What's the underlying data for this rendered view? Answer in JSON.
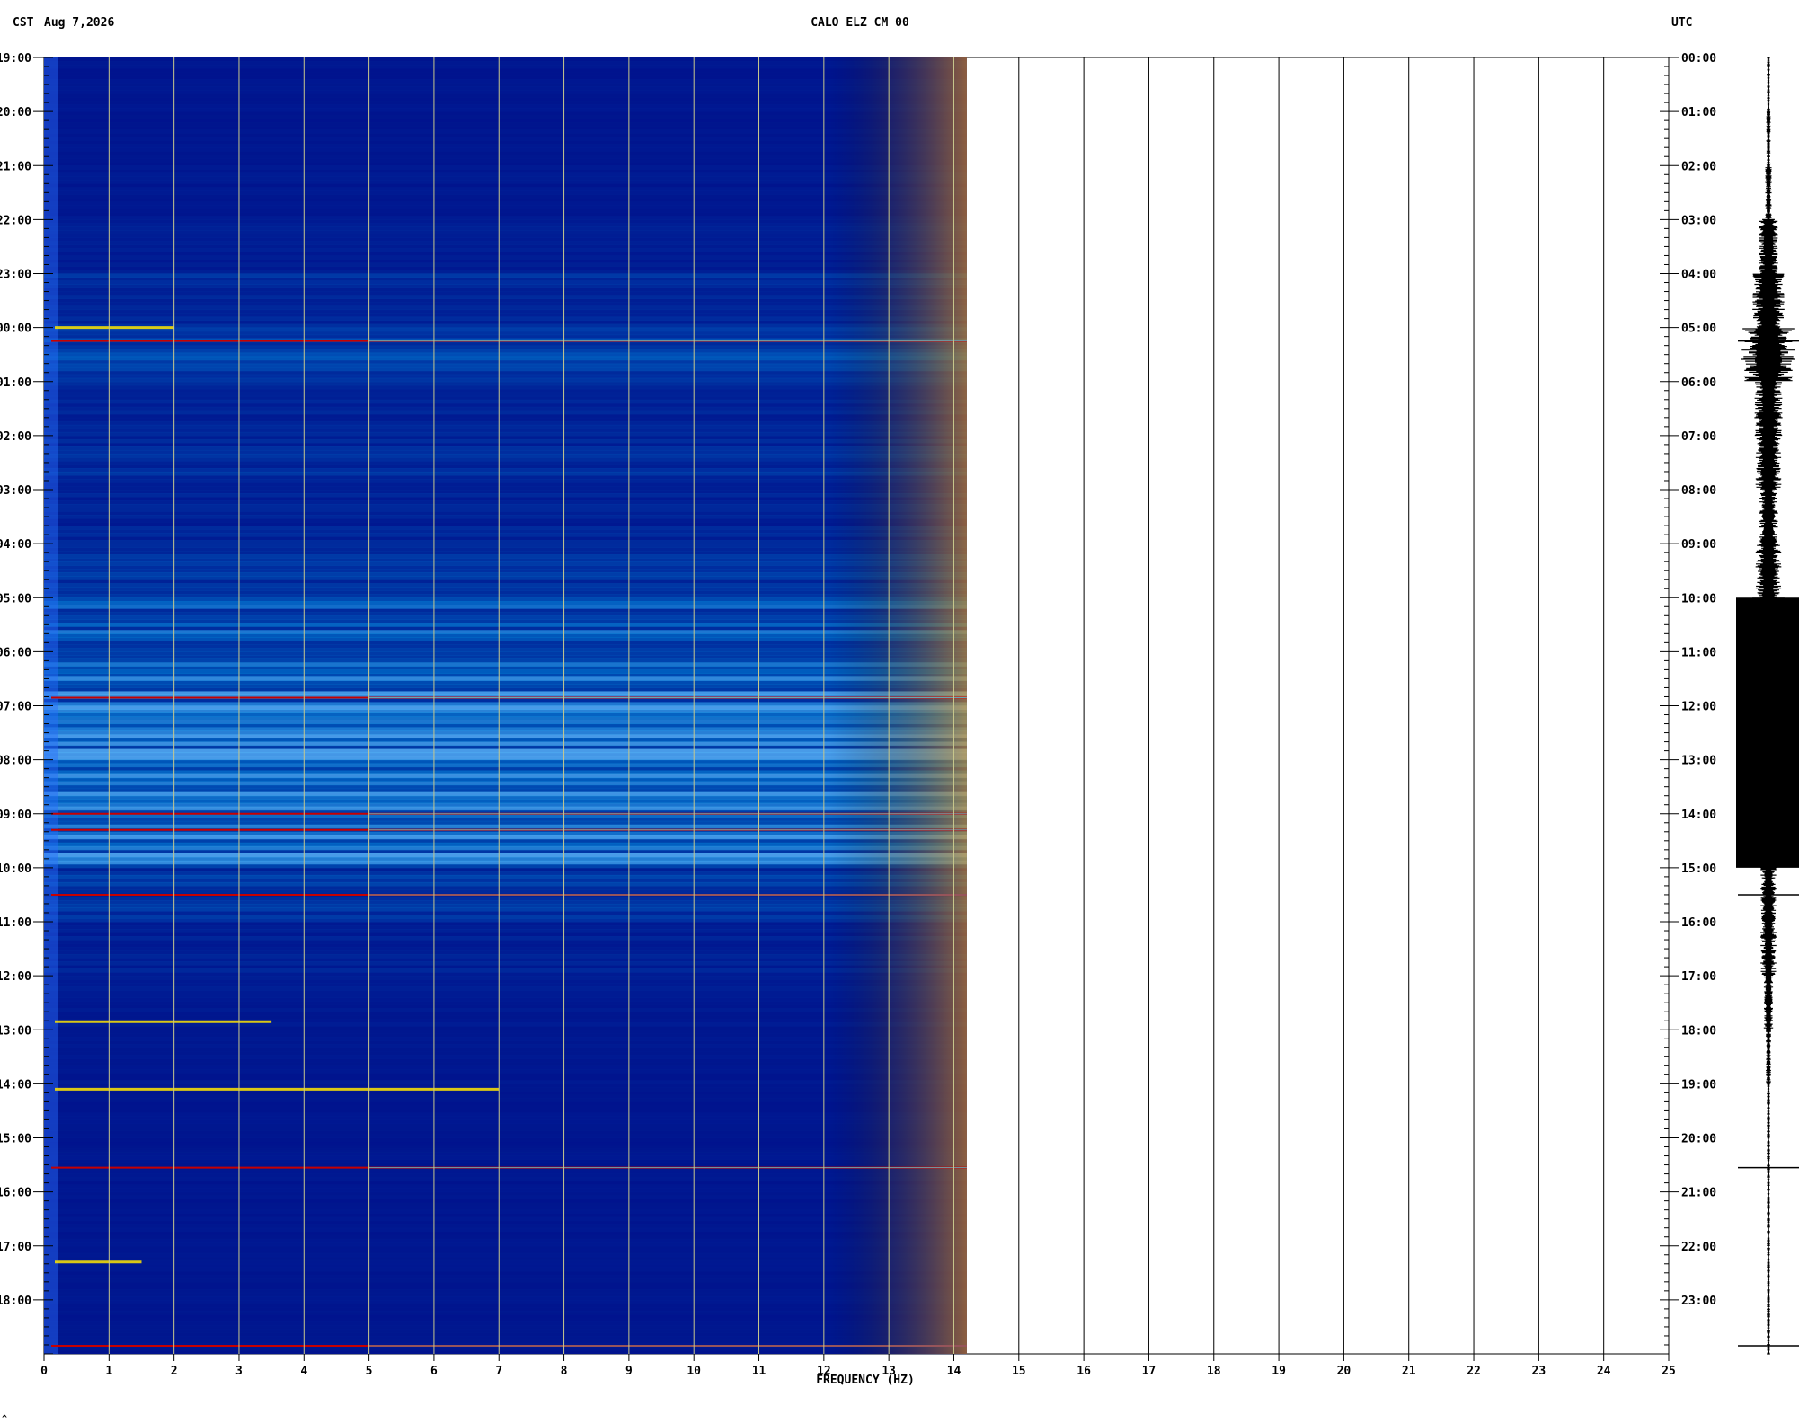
{
  "header": {
    "left_timezone": "CST",
    "date": "Aug 7,2026",
    "station": "CALO ELZ CM 00",
    "right_timezone": "UTC"
  },
  "footer_mark": "^",
  "colors": {
    "spectrogram_background": "#00108c",
    "grid_line": "#c8c88c",
    "right_grid_line": "#000000",
    "seismogram": "#000000",
    "highlight_red": "#c80000",
    "highlight_yellow": "#ffe600",
    "highlight_cyan": "#3cf0ff"
  },
  "chart_data": {
    "type": "heatmap",
    "xlabel": "FREQUENCY (HZ)",
    "xlim": [
      0,
      25
    ],
    "x_ticks": [
      "0",
      "1",
      "2",
      "3",
      "4",
      "5",
      "6",
      "7",
      "8",
      "9",
      "10",
      "11",
      "12",
      "13",
      "14",
      "15",
      "16",
      "17",
      "18",
      "19",
      "20",
      "21",
      "22",
      "23",
      "24",
      "25"
    ],
    "data_frequency_max_hz": 14.2,
    "left_time_labels": [
      "19:00",
      "20:00",
      "21:00",
      "22:00",
      "23:00",
      "00:00",
      "01:00",
      "02:00",
      "03:00",
      "04:00",
      "05:00",
      "06:00",
      "07:00",
      "08:00",
      "09:00",
      "10:00",
      "11:00",
      "12:00",
      "13:00",
      "14:00",
      "15:00",
      "16:00",
      "17:00",
      "18:00"
    ],
    "right_time_labels": [
      "00:00",
      "01:00",
      "02:00",
      "03:00",
      "04:00",
      "05:00",
      "06:00",
      "07:00",
      "08:00",
      "09:00",
      "10:00",
      "11:00",
      "12:00",
      "13:00",
      "14:00",
      "15:00",
      "16:00",
      "17:00",
      "18:00",
      "19:00",
      "20:00",
      "21:00",
      "22:00",
      "23:00"
    ],
    "utc_hours_span": 24,
    "intensity_profile_by_utc_hour": [
      0.1,
      0.1,
      0.12,
      0.2,
      0.32,
      0.45,
      0.28,
      0.3,
      0.25,
      0.35,
      0.6,
      0.68,
      0.78,
      0.7,
      0.72,
      0.4,
      0.22,
      0.16,
      0.12,
      0.1,
      0.1,
      0.1,
      0.1,
      0.1
    ],
    "seismogram_amplitude_by_utc_hour": [
      0.05,
      0.07,
      0.1,
      0.3,
      0.5,
      0.85,
      0.45,
      0.4,
      0.3,
      0.4,
      1.0,
      1.0,
      1.0,
      1.0,
      1.0,
      0.25,
      0.25,
      0.15,
      0.08,
      0.05,
      0.05,
      0.05,
      0.05,
      0.05
    ],
    "horizontal_event_lines_utc_hour": [
      5.25,
      11.85,
      14.0,
      14.3,
      15.5,
      20.55,
      23.85
    ],
    "low_frequency_bursts": [
      {
        "utc_hour": 5.0,
        "fmax": 2.0
      },
      {
        "utc_hour": 17.85,
        "fmax": 3.5
      },
      {
        "utc_hour": 19.1,
        "fmax": 7.0
      },
      {
        "utc_hour": 22.3,
        "fmax": 1.5
      }
    ]
  }
}
